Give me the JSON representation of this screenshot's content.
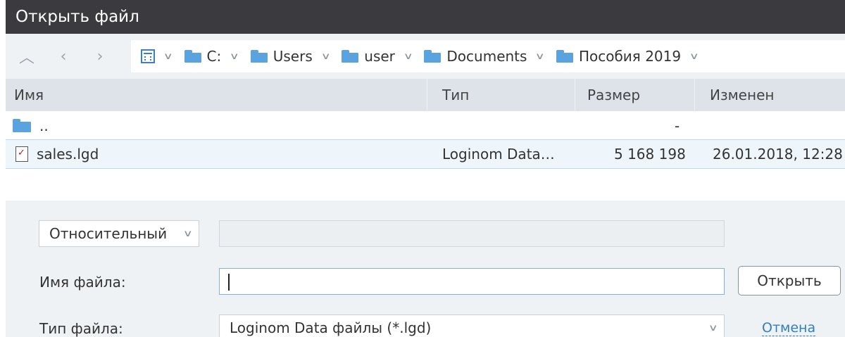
{
  "window": {
    "title": "Открыть файл"
  },
  "path": {
    "crumbs": [
      {
        "label": "C:"
      },
      {
        "label": "Users"
      },
      {
        "label": "user"
      },
      {
        "label": "Documents"
      },
      {
        "label": "Пособия 2019"
      }
    ]
  },
  "columns": {
    "name": "Имя",
    "type": "Тип",
    "size": "Размер",
    "modified": "Изменен"
  },
  "rows": [
    {
      "name": "..",
      "type": "",
      "size": "-",
      "modified": ""
    },
    {
      "name": "sales.lgd",
      "type": "Loginom Data…",
      "size": "5 168 198",
      "modified": "26.01.2018, 12:28"
    }
  ],
  "form": {
    "path_mode": "Относительный",
    "path_value": "",
    "filename_label": "Имя файла:",
    "filename_value": "",
    "filetype_label": "Тип файла:",
    "filetype_value": "Loginom Data файлы (*.lgd)",
    "open_button": "Открыть",
    "cancel_link": "Отмена"
  }
}
